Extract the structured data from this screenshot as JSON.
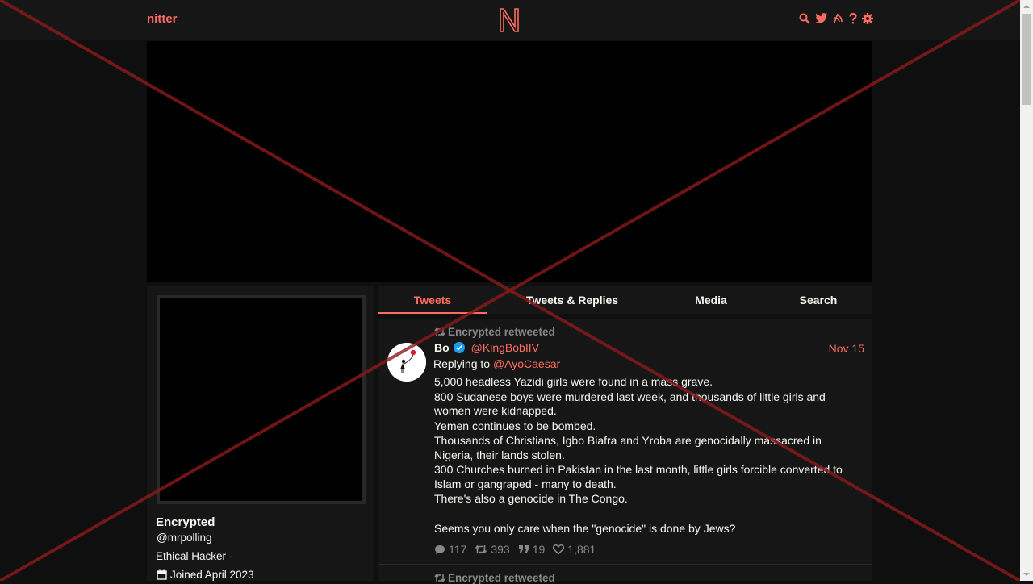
{
  "navbar": {
    "brand": "nitter",
    "logo_icon": "nitter-n-logo-icon",
    "icons": [
      "search-icon",
      "twitter-bird-icon",
      "rss-icon",
      "help-icon",
      "settings-gear-icon"
    ]
  },
  "profile": {
    "fullname": "Encrypted",
    "username": "@mrpolling",
    "bio": "Ethical Hacker -",
    "joined": "Joined April 2023"
  },
  "tabs": [
    {
      "label": "Tweets",
      "active": true
    },
    {
      "label": "Tweets & Replies",
      "active": false
    },
    {
      "label": "Media",
      "active": false
    },
    {
      "label": "Search",
      "active": false
    }
  ],
  "tweets": [
    {
      "retweet_header": "Encrypted retweeted",
      "fullname": "Bo",
      "verified": true,
      "username": "@KingBobIIV",
      "date": "Nov 15",
      "replying_to_label": "Replying to",
      "replying_to": "@AyoCaesar",
      "content": [
        "5,000 headless Yazidi girls were found in a mass grave.",
        "800 Sudanese boys were murdered last week, and thousands of little girls and women were kidnapped.",
        "Yemen continues to be bombed.",
        "Thousands of Christians, Igbo  Biafra and Yroba are genocidally massacred in Nigeria, their lands stolen.",
        "300 Churches burned in Pakistan in the last month, little girls forcible converted to Islam or gangraped - many to death.",
        "There's also a genocide in The Congo.",
        "",
        "Seems you only care when the \"genocide\" is done by Jews?"
      ],
      "stats": {
        "replies": "117",
        "retweets": "393",
        "quotes": "19",
        "likes": "1,881"
      }
    },
    {
      "retweet_header": "Encrypted retweeted"
    }
  ],
  "colors": {
    "accent": "#ff6c60",
    "background": "#0f0f0f",
    "panel": "#161616",
    "muted": "#888889",
    "overlay_cross": "#8b1a1a"
  }
}
